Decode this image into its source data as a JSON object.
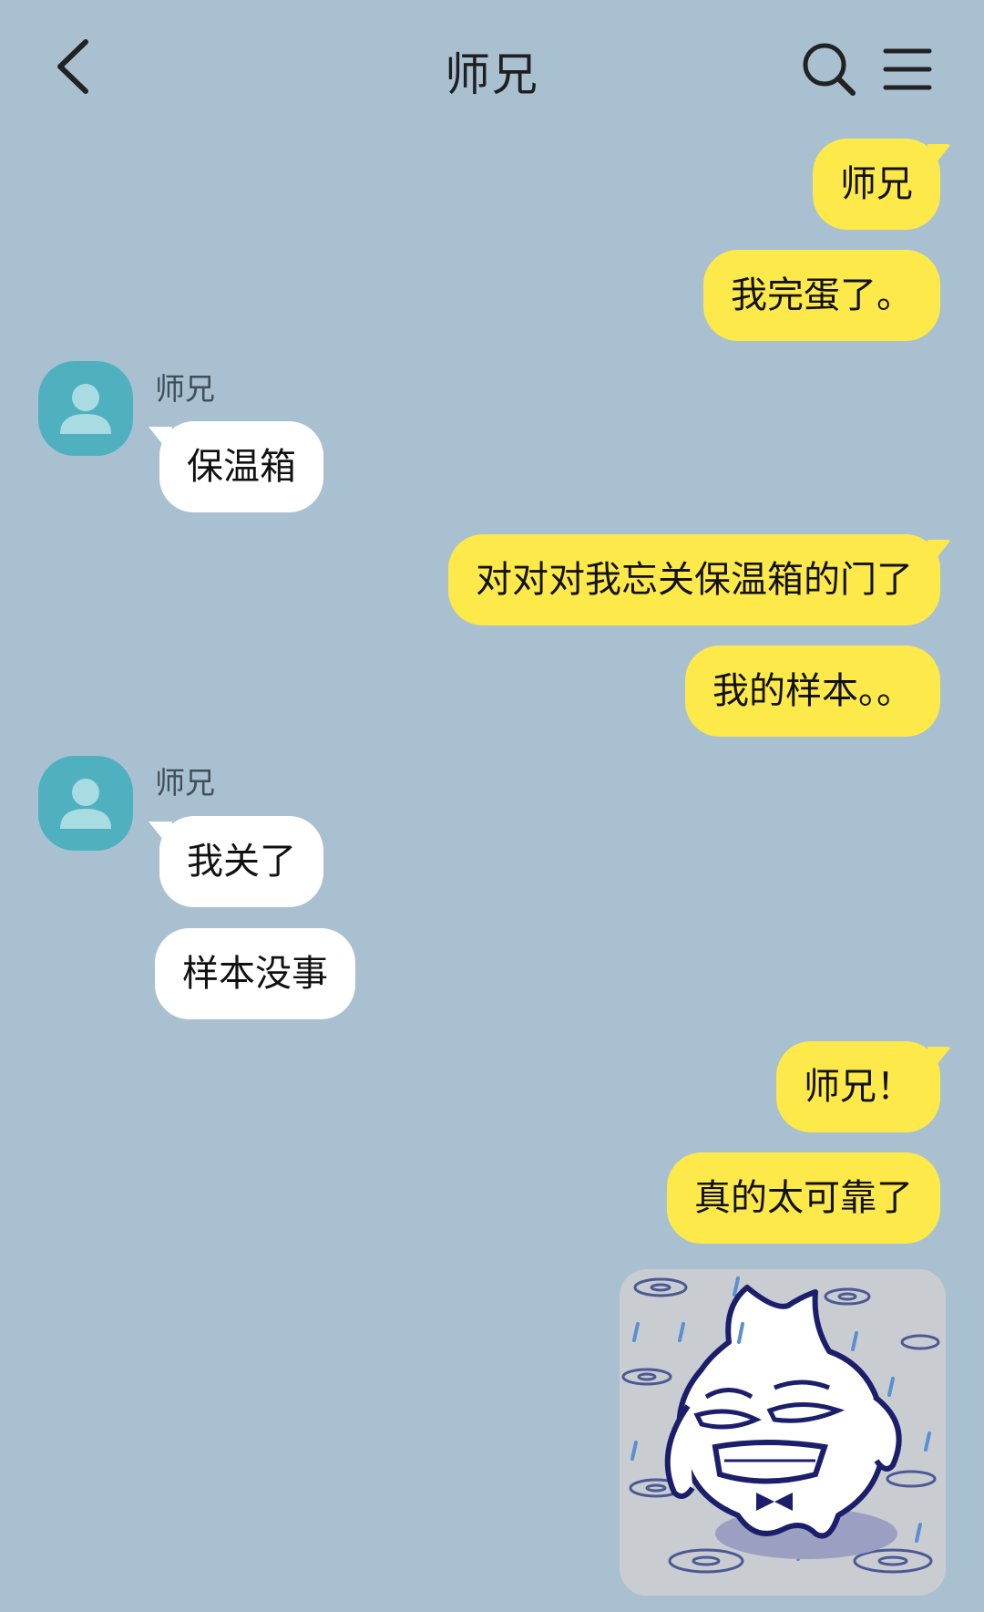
{
  "header": {
    "title": "师兄",
    "back_icon": "chevron-left-icon",
    "search_icon": "search-icon",
    "menu_icon": "menu-icon"
  },
  "contact": {
    "name": "师兄",
    "avatar_icon": "person-avatar-icon"
  },
  "colors": {
    "background": "#a9c0d1",
    "my_bubble": "#fee94a",
    "their_bubble": "#ffffff",
    "avatar": "#4fb0c0"
  },
  "messages": [
    {
      "from": "me",
      "text": "师兄"
    },
    {
      "from": "me",
      "text": "我完蛋了。"
    },
    {
      "from": "them",
      "text": "保温箱"
    },
    {
      "from": "me",
      "text": "对对对我忘关保温箱的门了"
    },
    {
      "from": "me",
      "text": "我的样本。。"
    },
    {
      "from": "them",
      "text": "我关了"
    },
    {
      "from": "them",
      "text": "样本没事"
    },
    {
      "from": "me",
      "text": "师兄！"
    },
    {
      "from": "me",
      "text": "真的太可靠了"
    },
    {
      "from": "me",
      "type": "sticker",
      "sticker_icon": "crying-ghost-sticker"
    }
  ]
}
